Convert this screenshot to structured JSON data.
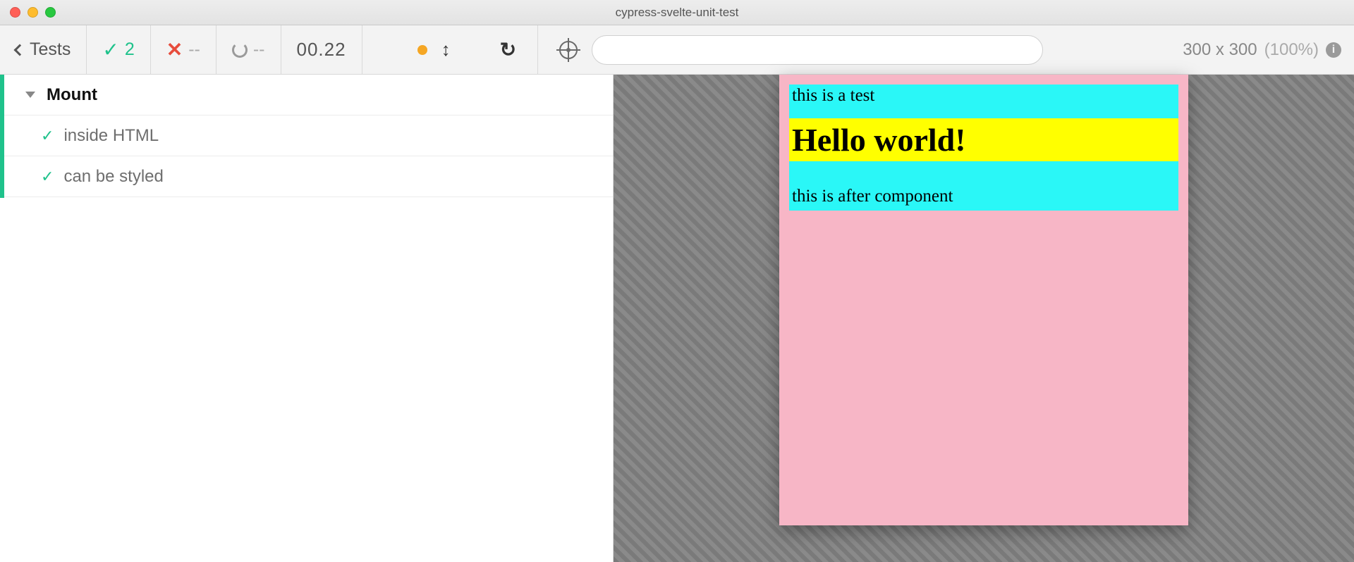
{
  "window": {
    "title": "cypress-svelte-unit-test"
  },
  "toolbar": {
    "tests_label": "Tests",
    "pass_count": "2",
    "fail_count": "--",
    "pending_count": "--",
    "timer": "00.22",
    "viewport": "300 x 300",
    "zoom": "(100%)"
  },
  "url_input": {
    "value": "",
    "placeholder": ""
  },
  "reporter": {
    "suite": "Mount",
    "tests": [
      {
        "title": "inside HTML",
        "state": "passed"
      },
      {
        "title": "can be styled",
        "state": "passed"
      }
    ]
  },
  "aut": {
    "line_before": "this is a test",
    "heading": "Hello world!",
    "line_after": "this is after component"
  }
}
